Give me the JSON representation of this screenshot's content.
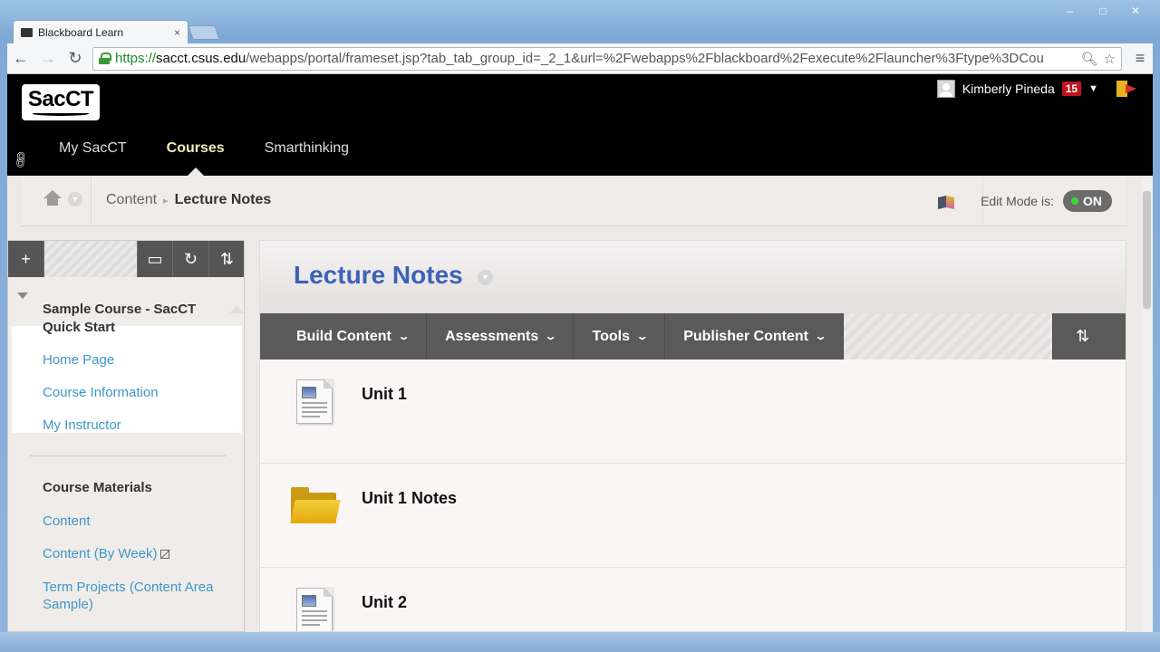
{
  "browser": {
    "tab_title": "Blackboard Learn",
    "tab_close": "×",
    "url_scheme": "https://",
    "url_host": "sacct.csus.edu",
    "url_path": "/webapps/portal/frameset.jsp?tab_tab_group_id=_2_1&url=%2Fwebapps%2Fblackboard%2Fexecute%2Flauncher%3Ftype%3DCou",
    "window_minimize": "‒",
    "window_maximize": "□",
    "window_close": "✕"
  },
  "header": {
    "logo_text": "SacCT",
    "user_name": "Kimberly Pineda",
    "notification_count": "15",
    "nav": [
      "My SacCT",
      "Courses",
      "Smarthinking"
    ],
    "active_nav": "Courses"
  },
  "breadcrumb": {
    "items": [
      "Content",
      "Lecture Notes"
    ],
    "edit_mode_label": "Edit Mode is:",
    "edit_mode_value": "ON"
  },
  "course_menu": {
    "course_title": "Sample Course - SacCT Quick Start",
    "links": [
      "Home Page",
      "Course Information",
      "My Instructor"
    ],
    "section_heading": "Course Materials",
    "section_links": [
      "Content",
      "Content (By Week)",
      "Term Projects (Content Area Sample)"
    ]
  },
  "content": {
    "title": "Lecture Notes",
    "actions": [
      "Build Content",
      "Assessments",
      "Tools",
      "Publisher Content"
    ],
    "items": [
      {
        "title": "Unit 1",
        "icon": "document-icon"
      },
      {
        "title": "Unit 1 Notes",
        "icon": "folder-icon"
      },
      {
        "title": "Unit 2",
        "icon": "document-icon"
      }
    ]
  },
  "colors": {
    "header_bg": "#000000",
    "active_nav": "#f5e9b8",
    "link": "#3d97c9",
    "content_title": "#3b62b8",
    "action_bar": "#5a5a5a",
    "toggle_on": "#3cd63c",
    "notification": "#c1121f"
  }
}
